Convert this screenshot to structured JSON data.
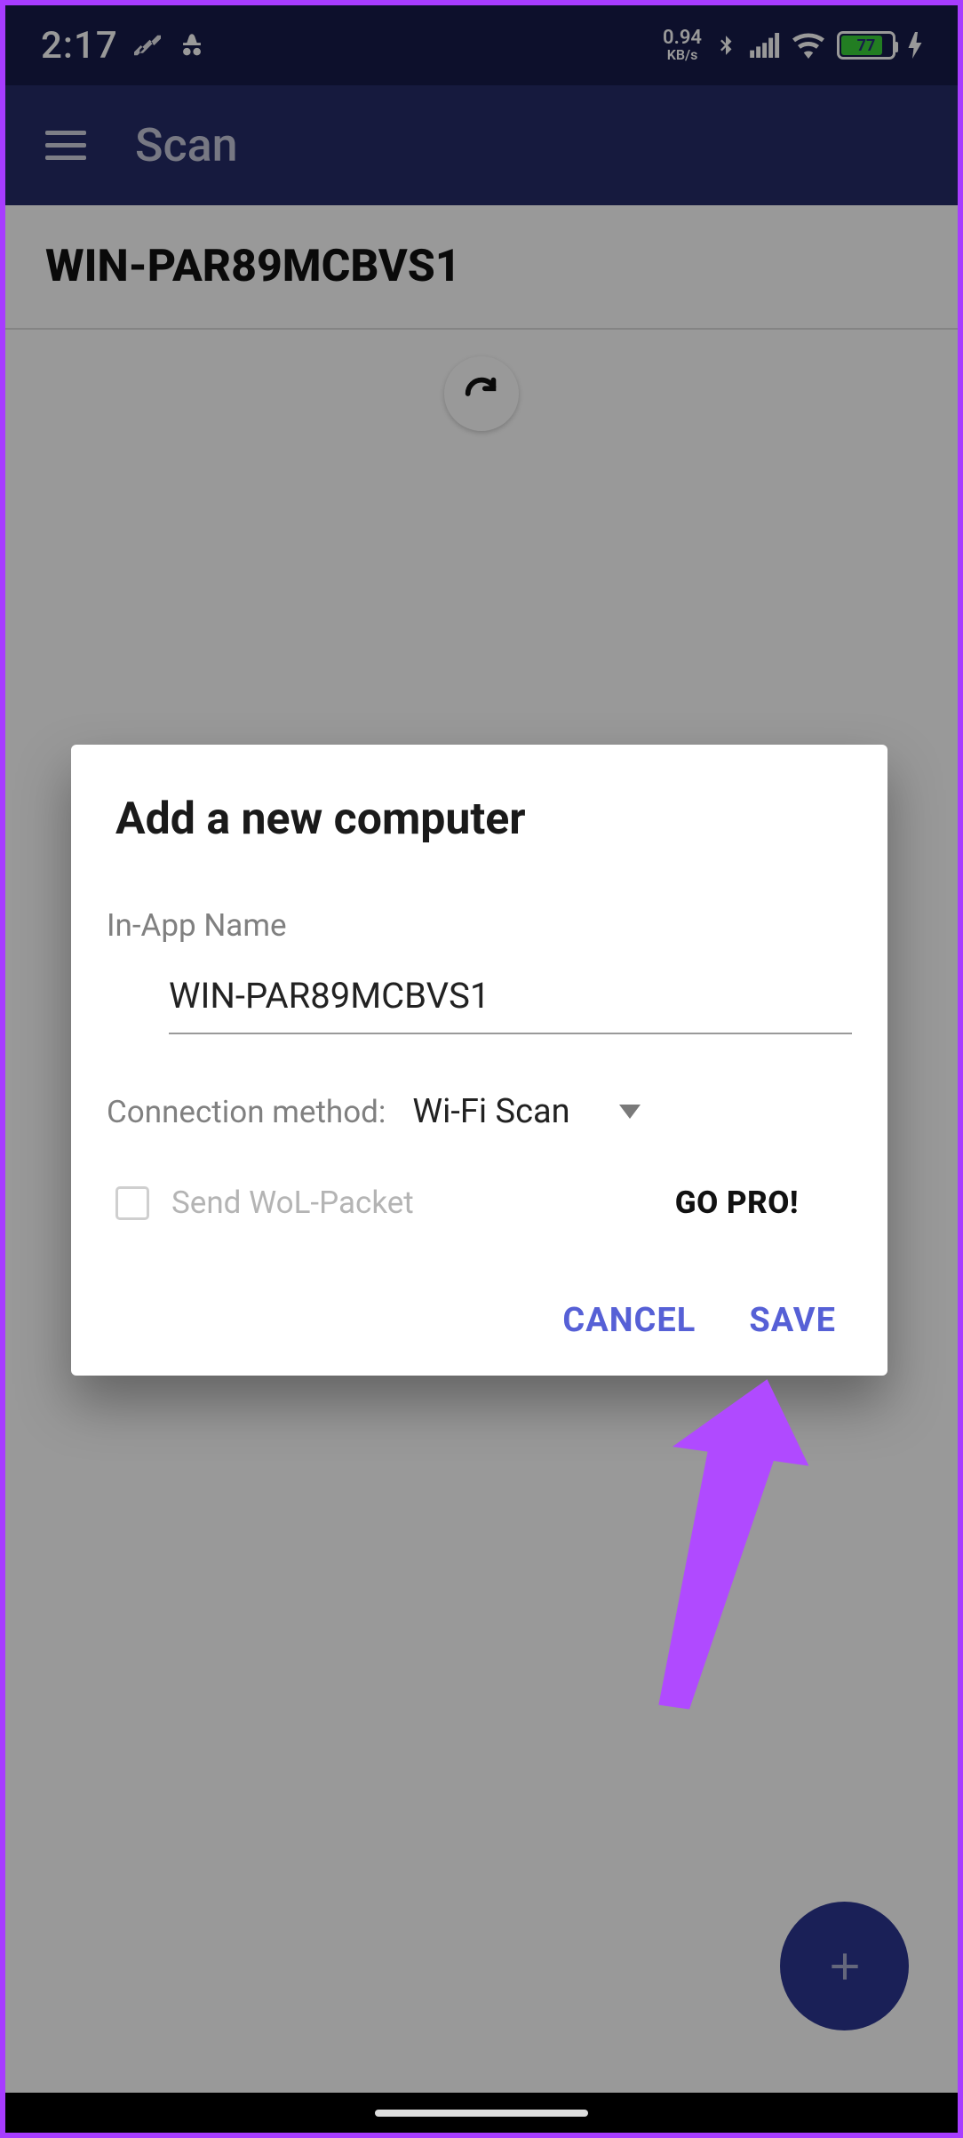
{
  "statusbar": {
    "time": "2:17",
    "speed_value": "0.94",
    "speed_unit": "KB/s",
    "battery_pct": "77"
  },
  "appbar": {
    "title": "Scan"
  },
  "main": {
    "header": "WIN-PAR89MCBVS1"
  },
  "dialog": {
    "title": "Add a new computer",
    "name_label": "In-App Name",
    "name_value": "WIN-PAR89MCBVS1",
    "connection_label": "Connection method:",
    "connection_selected": "Wi-Fi Scan",
    "wol_label": "Send WoL-Packet",
    "wol_checked": false,
    "go_pro": "GO PRO!",
    "cancel": "CANCEL",
    "save": "SAVE"
  },
  "colors": {
    "accent": "#5660d6",
    "appbar_bg": "#252c68",
    "statusbar_bg": "#171c4a",
    "annotation": "#b04aff"
  }
}
